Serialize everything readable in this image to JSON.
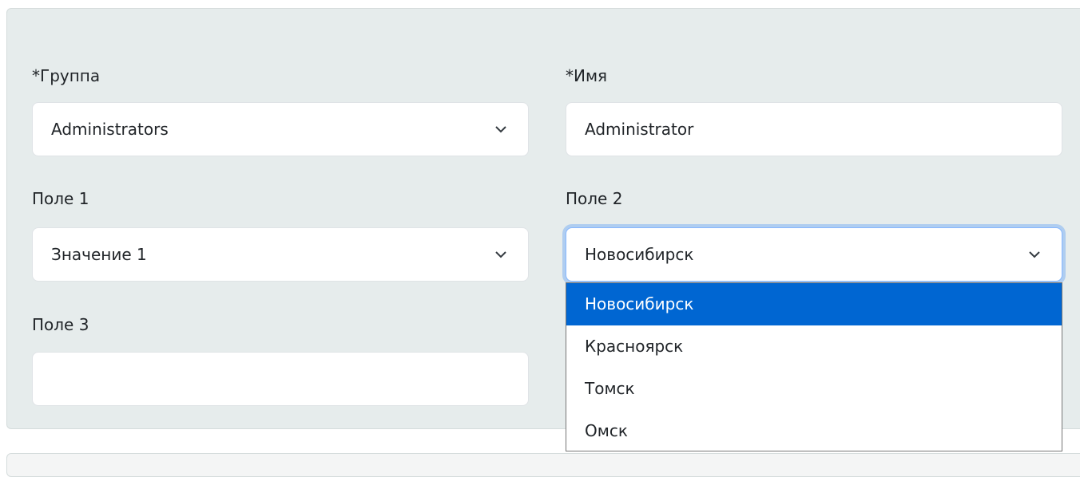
{
  "form": {
    "group": {
      "label": "*Группа",
      "value": "Administrators"
    },
    "name": {
      "label": "*Имя",
      "value": "Administrator"
    },
    "field1": {
      "label": "Поле 1",
      "value": "Значение 1"
    },
    "field2": {
      "label": "Поле 2",
      "value": "Новосибирск"
    },
    "field3": {
      "label": "Поле 3",
      "value": ""
    }
  },
  "dropdown": {
    "options": [
      "Новосибирск",
      "Красноярск",
      "Томск",
      "Омск"
    ],
    "selected_index": 0
  },
  "colors": {
    "panel_bg": "#e6ecec",
    "selected_bg": "#0066d2",
    "focus_ring": "#86b7fe"
  },
  "icons": {
    "select_arrow": "chevron-down-icon"
  }
}
